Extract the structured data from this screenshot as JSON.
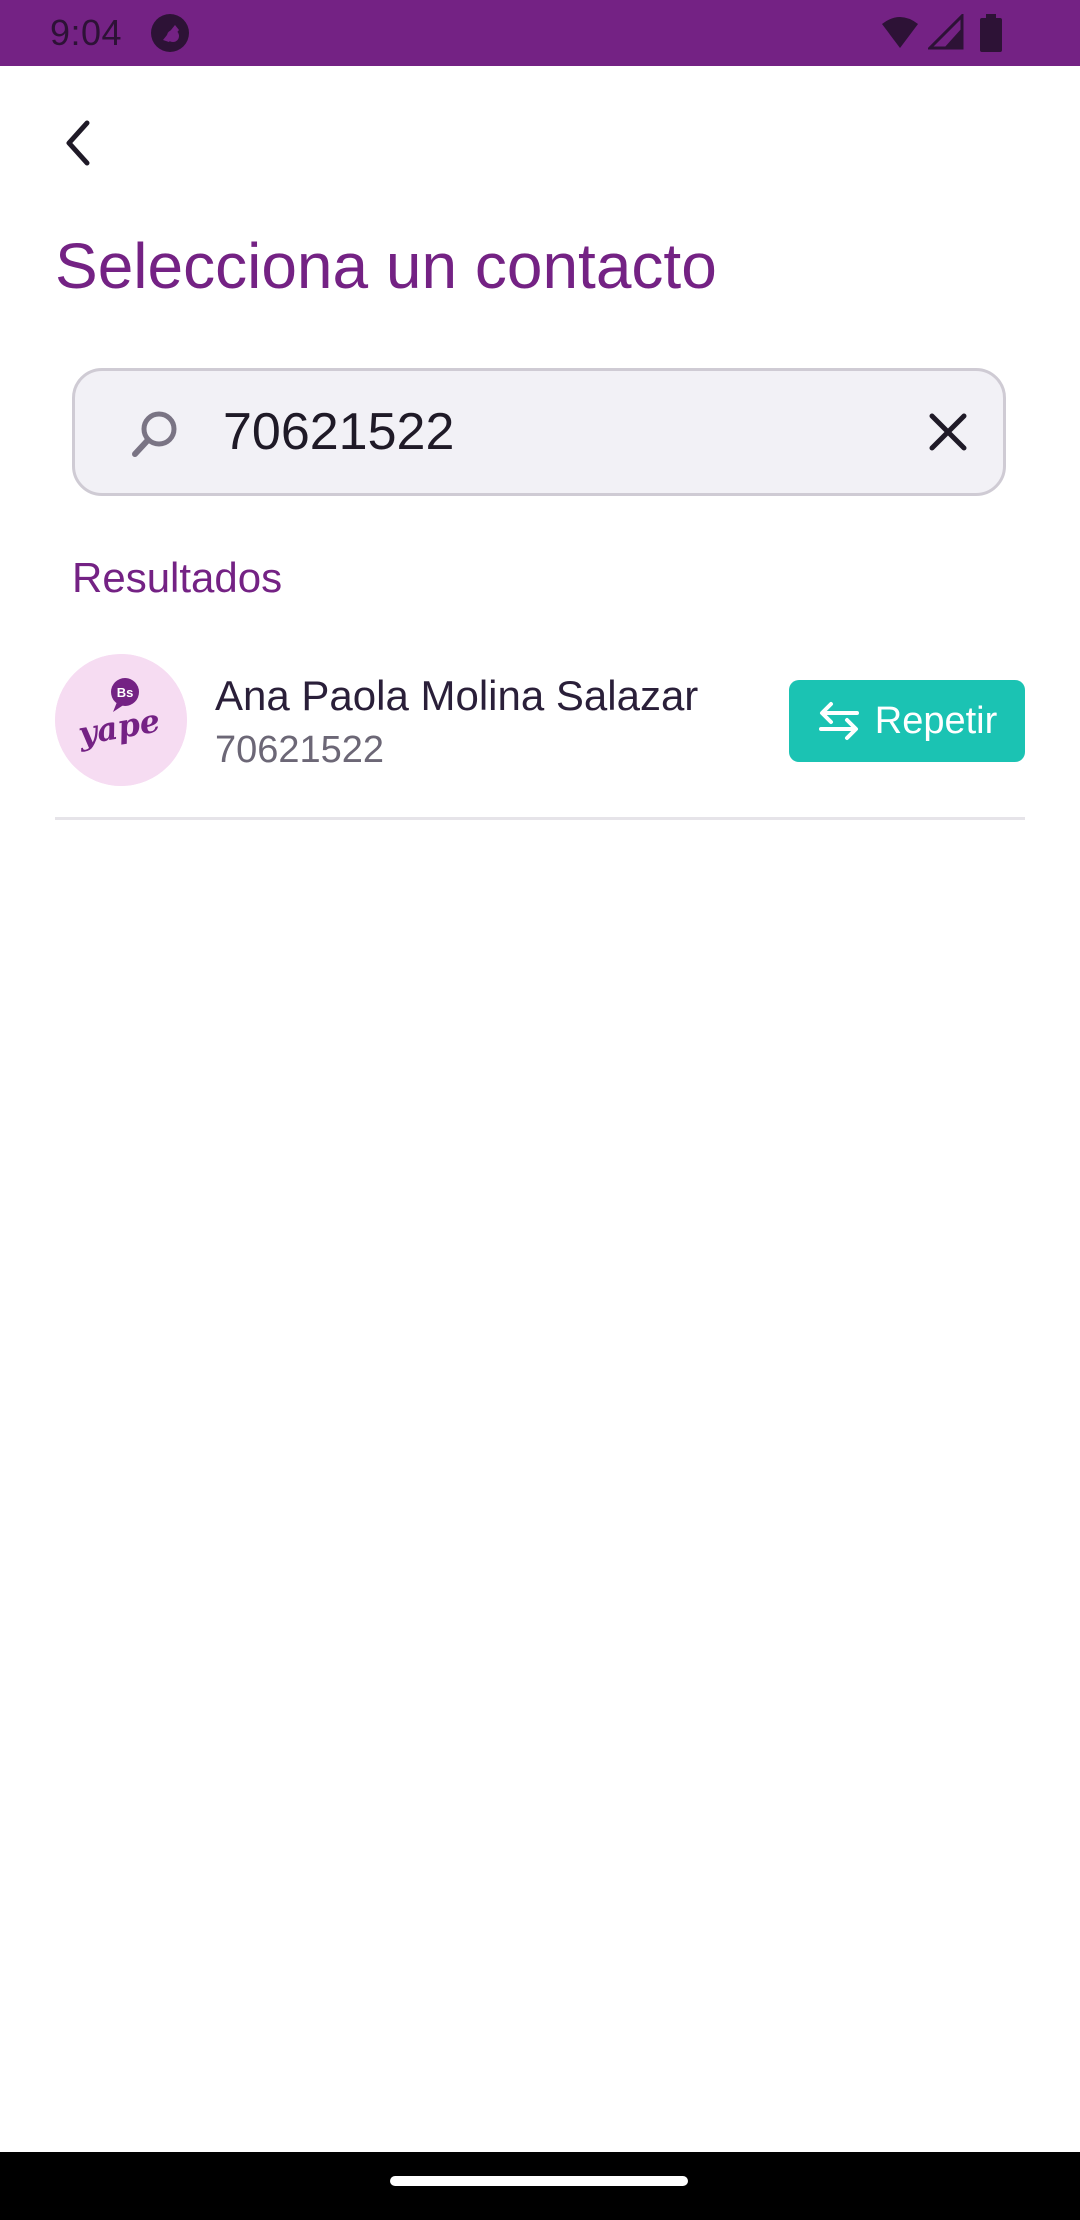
{
  "status_bar": {
    "time": "9:04",
    "color": "#742284",
    "icons": [
      "app-notification-icon",
      "wifi-icon",
      "signal-icon",
      "battery-icon"
    ]
  },
  "header": {
    "back_icon": "chevron-left-icon",
    "title": "Selecciona un contacto"
  },
  "search": {
    "value": "70621522",
    "search_icon": "search-icon",
    "clear_icon": "close-icon"
  },
  "results": {
    "label": "Resultados",
    "items": [
      {
        "name": "Ana Paola Molina Salazar",
        "phone": "70621522",
        "avatar_icon": "yape-logo-icon",
        "avatar_text": "yape",
        "avatar_badge": "Bs",
        "action_label": "Repetir",
        "action_icon": "swap-arrows-icon"
      }
    ]
  },
  "colors": {
    "brand_purple": "#742284",
    "accent_teal": "#1bc3b3",
    "avatar_bg": "#f6dcf2"
  }
}
